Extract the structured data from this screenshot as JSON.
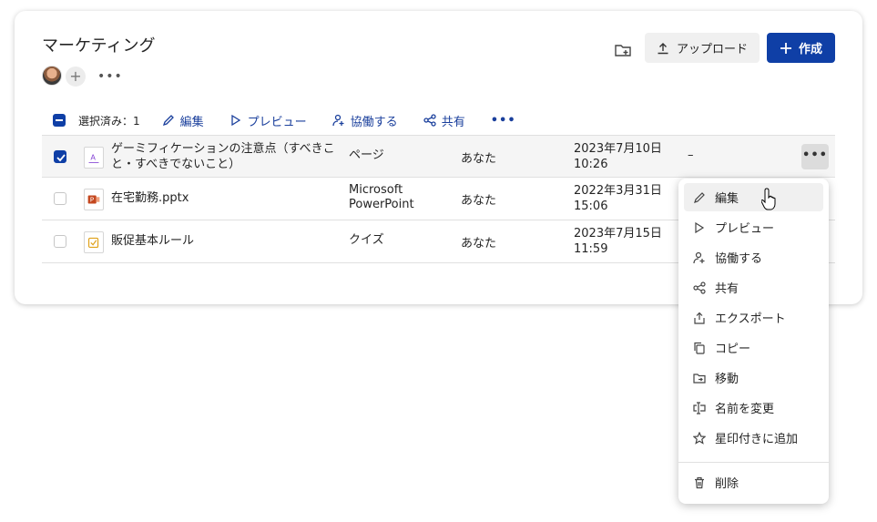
{
  "header": {
    "title": "マーケティング",
    "more_members": "•••",
    "add_member": "+",
    "upload_label": "アップロード",
    "create_label": "作成"
  },
  "toolbar": {
    "selected": "選択済み：1",
    "edit": "編集",
    "preview": "プレビュー",
    "collaborate": "協働する",
    "share": "共有",
    "more": "•••"
  },
  "files": [
    {
      "name": "ゲーミフィケーションの注意点（すべきこと・すべきでないこと）",
      "type": "ページ",
      "owner": "あなた",
      "date": "2023年7月10日",
      "time": "10:26",
      "shared": "–",
      "selected": true,
      "icon": "page-icon"
    },
    {
      "name": "在宅勤務.pptx",
      "type_line1": "Microsoft",
      "type_line2": "PowerPoint",
      "owner": "あなた",
      "date": "2022年3月31日",
      "time": "15:06",
      "selected": false,
      "icon": "powerpoint-icon"
    },
    {
      "name": "販促基本ルール",
      "type": "クイズ",
      "owner": "あなた",
      "date": "2023年7月15日",
      "time": "11:59",
      "selected": false,
      "icon": "quiz-icon"
    }
  ],
  "row_more": "•••",
  "context_menu": {
    "items": [
      "編集",
      "プレビュー",
      "協働する",
      "共有",
      "エクスポート",
      "コピー",
      "移動",
      "名前を変更",
      "星印付きに追加",
      "削除"
    ]
  },
  "colors": {
    "accent": "#0f3fa6",
    "link": "#1a3f9c"
  }
}
